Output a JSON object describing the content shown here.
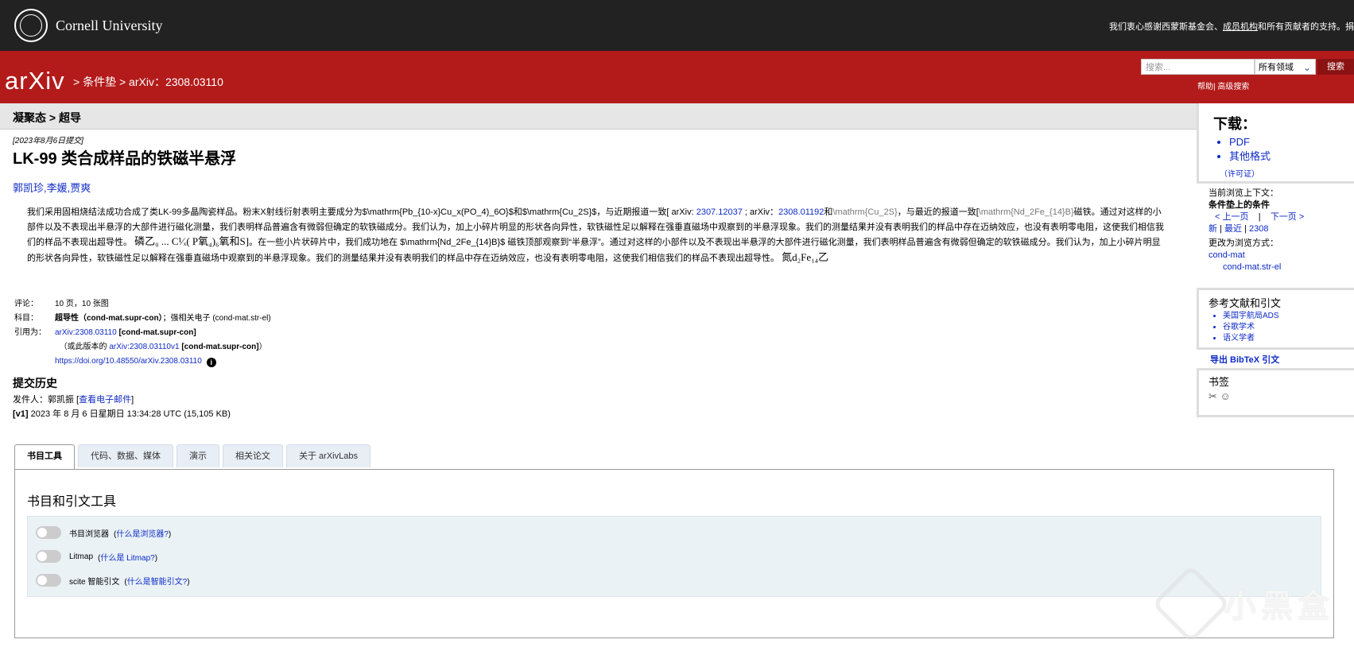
{
  "topbar": {
    "institution": "Cornell University",
    "support_prefix": "我们衷心感谢西蒙斯基金会、",
    "support_link": "成员机构",
    "support_suffix": "和所有贡献者的支持。捐"
  },
  "header": {
    "logo": "arXiv",
    "breadcrumb_sep1": ">",
    "breadcrumb_cat": "条件垫",
    "breadcrumb_sep2": ">",
    "breadcrumb_id": "arXiv：2308.03110",
    "search_placeholder": "搜索...",
    "search_field": "所有领域",
    "search_button": "搜索",
    "help": "帮助",
    "advanced": "| 高级搜索"
  },
  "subject_band": "凝聚态 > 超导",
  "paper": {
    "submitted": "[2023年8月6日提交]",
    "title": "LK-99 类合成样品的铁磁半悬浮",
    "authors": "郭凯珍,李媛,贾爽",
    "abstract": {
      "p1": "我们采用固相烧结法成功合成了类LK-99多晶陶瓷样品。粉末X射线衍射表明主要成分为$\\mathrm{Pb_{10-x}Cu_x(PO_4)_6O}$和$\\mathrm{Cu_2S}$，与近期报道一致[ arXiv: ",
      "link1": "2307.12037",
      "p2": " ; arXiv：",
      "link2": "2308.01192",
      "p3": "和",
      "hl1": "\\mathrm{Cu_2S}",
      "p4": "，与最近的报道一致[",
      "hl2": "\\mathrm{Nd_2Fe_{14}B}",
      "p5": "磁铁。通过对这样的小部件以及不表现出半悬浮的大部件进行磁化测量，我们表明样品普遍含有微弱但确定的软铁磁成分。我们认为，加上小碎片明显的形状各向异性，软铁磁性足以解释在强垂直磁场中观察到的半悬浮现象。我们的测量结果并没有表明我们的样品中存在迈纳效应，也没有表明零电阻，这使我们相信我们的样品不表现出超导性。",
      "math1": "磷乙₀ ... C¹⁄ₓ( P氧₄)₆氧和S]",
      "p6": "。在一些小片状碎片中，我们成功地在 $\\mathrm{Nd_2Fe_{14}B}$ 磁铁顶部观察到“半悬浮”。通过对这样的小部件以及不表现出半悬浮的大部件进行磁化测量，我们表明样品普遍含有微弱但确定的软铁磁成分。我们认为，加上小碎片明显的形状各向异性，软铁磁性足以解释在强垂直磁场中观察到的半悬浮现象。我们的测量结果并没有表明我们的样品中存在迈纳效应，也没有表明零电阻，这使我们相信我们的样品不表现出超导性。",
      "math2": "氮d₂Fe₁₄乙"
    },
    "meta": {
      "comment_label": "评论：",
      "comment": "10 页，10 张图",
      "subject_label": "科目：",
      "subject_main": "超导性（cond-mat.supr-con）",
      "subject_rest": "；强相关电子 (cond-mat.str-el)",
      "cite_label": "引用为：",
      "cite_link": "arXiv:2308.03110",
      "cite_cat": "[cond-mat.supr-con]",
      "cite_version_prefix": "（或此版本的",
      "cite_version_link": "arXiv:2308.03110v1",
      "cite_version_cat": "[cond-mat.supr-con]",
      "cite_version_suffix": "）",
      "doi": "https://doi.org/10.48550/arXiv.2308.03110",
      "info_icon": "i"
    },
    "history": {
      "title": "提交历史",
      "from_prefix": "发件人：郭凯振 [",
      "from_link": "查看电子邮件",
      "from_suffix": "]",
      "v1_tag": "[v1]",
      "v1_text": " 2023 年 8 月 6 日星期日 13:34:28 UTC (15,105 KB)"
    }
  },
  "sidebar": {
    "download_title": "下载：",
    "download_items": [
      "PDF",
      "其他格式"
    ],
    "license": "（许可证）",
    "context_label": "当前浏览上下文：",
    "context_value": "条件垫上的条件",
    "prev": "< 上一页",
    "sep": "|",
    "next": "下一页 >",
    "new": "新",
    "recent": "最近",
    "month": "2308",
    "change_label": "更改为浏览方式：",
    "change_a": "cond-mat",
    "change_b": "cond-mat.str-el",
    "refs_title": "参考文献和引文",
    "refs_items": [
      "美国宇航局ADS",
      "谷歌学术",
      "语义学者"
    ],
    "bibtex": "导出 BibTeX 引文",
    "bookmark_title": "书签",
    "bookmark_icons": "✂ ☺"
  },
  "tabs": [
    "书目工具",
    "代码、数据、媒体",
    "演示",
    "相关论文",
    "关于 arXivLabs"
  ],
  "panel": {
    "title": "书目和引文工具",
    "toggles": [
      {
        "label": "书目浏览器",
        "help": "什么是浏览器?"
      },
      {
        "label": "Litmap",
        "help": "什么是 Litmap?"
      },
      {
        "label": "scite 智能引文",
        "help": "什么是智能引文?"
      }
    ]
  },
  "watermark": "小黑盒"
}
